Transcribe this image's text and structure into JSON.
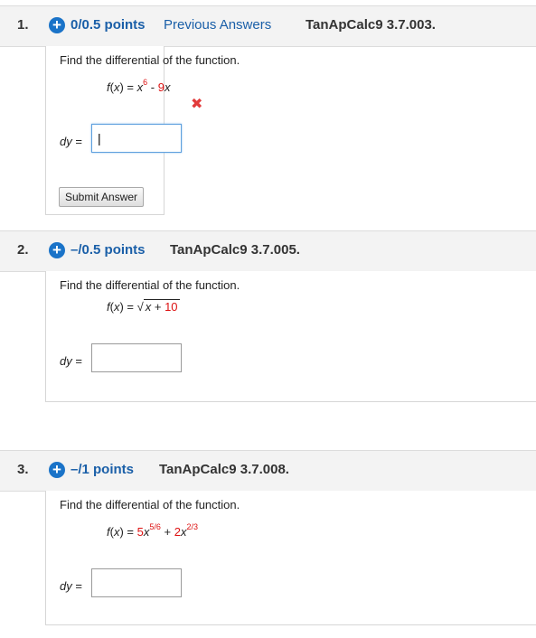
{
  "questions": [
    {
      "number": "1.",
      "points": "0/0.5 points",
      "previous_answers": "Previous Answers",
      "source": "TanApCalc9 3.7.003.",
      "instruction": "Find the differential of the function.",
      "fx_label": "f(x) = x",
      "fx_exp": "6",
      "fx_rest": " - 9x",
      "dy_label": "dy =",
      "answer_value": "|",
      "feedback": "incorrect",
      "submit_label": "Submit Answer"
    },
    {
      "number": "2.",
      "points": "–/0.5 points",
      "source": "TanApCalc9 3.7.005.",
      "instruction": "Find the differential of the function.",
      "fx_label": "f(x) = ",
      "fx_radicand": "x + 10",
      "dy_label": "dy ="
    },
    {
      "number": "3.",
      "points": "–/1 points",
      "source": "TanApCalc9 3.7.008.",
      "instruction": "Find the differential of the function.",
      "fx_label": "f(x) = 5x",
      "fx_exp1": "5/6",
      "fx_mid": " + 2x",
      "fx_exp2": "2/3",
      "dy_label": "dy ="
    }
  ],
  "colors": {
    "link": "#1a5fa8",
    "plus_icon": "#1a73c8",
    "coefficient": "#d11",
    "incorrect": "#e23b3b"
  }
}
